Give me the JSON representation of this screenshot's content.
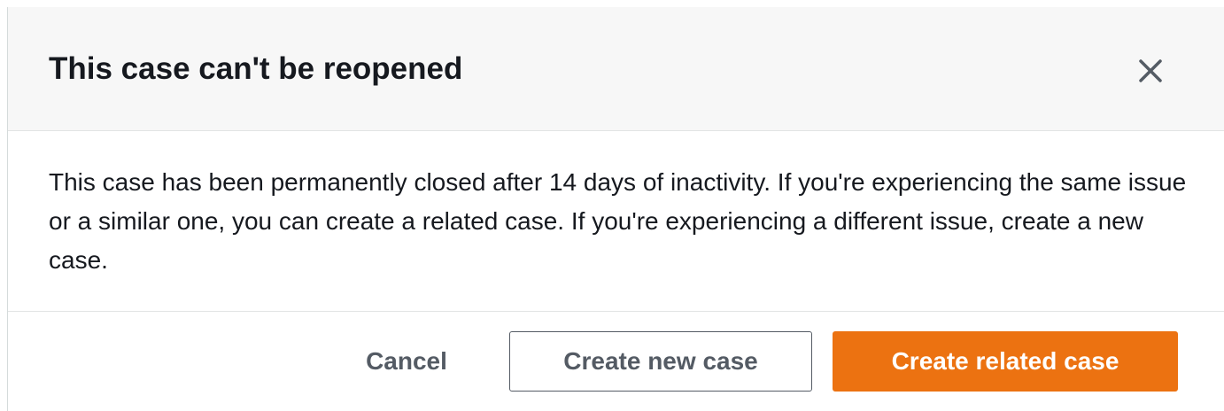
{
  "modal": {
    "title": "This case can't be reopened",
    "close_icon": "close-icon",
    "body": "This case has been permanently closed after 14 days of inactivity. If you're experiencing the same issue or a similar one, you can create a related case. If you're experiencing a different issue, create a new case.",
    "buttons": {
      "cancel_label": "Cancel",
      "create_new_label": "Create new case",
      "create_related_label": "Create related case"
    }
  },
  "colors": {
    "primary": "#ec7211",
    "text": "#16191f",
    "secondary_text": "#545b64",
    "header_bg": "#f7f7f7"
  }
}
